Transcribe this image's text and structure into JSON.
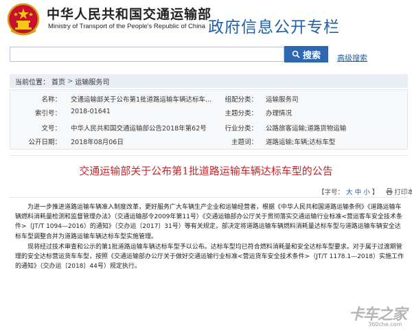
{
  "header": {
    "ministry_cn": "中华人民共和国交通运输部",
    "ministry_en": "Ministry of Transport of the People's Republic of China",
    "column_title": "政府信息公开专栏"
  },
  "search": {
    "placeholder": "",
    "button_label": "搜索",
    "advanced_label": "高级搜索"
  },
  "breadcrumb": {
    "prefix": "当前位置：",
    "home": "首页",
    "sep": ">",
    "current": "运输服务司"
  },
  "info": {
    "name_label": "名称：",
    "name_value": "交通运输部关于公布第1批道路运输车辆达标车...",
    "index_label": "索引号：",
    "index_value": "2018-01641",
    "docno_label": "文号：",
    "docno_value": "中华人民共和国交通运输部公告2018年第62号",
    "date_label": "公开日期：",
    "date_value": "2018年08月06日",
    "org_label": "组配分类：",
    "org_value": "运输服务司",
    "topic_label": "主题分类：",
    "topic_value": "办理情况",
    "industry_label": "行业分类：",
    "industry_value": "公路旅客运输;道路货物运输",
    "keyword_label": "主题词：",
    "keyword_value": "道路运输;车辆;达标车型"
  },
  "article": {
    "title": "交通运输部关于公布第1批道路运输车辆达标车型的公告",
    "font_label": "【字号：",
    "font_large": "大",
    "font_medium": "中",
    "font_small": "小",
    "font_close": "】",
    "print_label": "打印本页",
    "paragraph_1": "为进一步推进道路运输车辆准入制度改革，更好服务广大车辆生产企业和运输经营者，根据《中华人民共和国道路运输条例》《道路运输车辆燃料消耗量检测和监督管理办法》（交通运输部令2009年第11号）《交通运输部办公厅关于贯彻落实交通运输行业标准<营运客车安全技术条件>（JT/T 1094—2016）的通知》（交办运〔2017〕31号）等有关规定，部决定将道路运输车辆燃料消耗量达标车型与道路运输车辆安全达标车型调整合并为道路运输车辆达标车型实施管理。",
    "paragraph_2": "现将经过技术审查和公示的第1批道路运输车辆达标车型予以公布。达标车型均已符合燃料消耗量和安全达标车型要求。对于属于过渡期管理的安全达标营运货车车型，按照《交通运输部办公厅关于做好交通运输行业标准<营运货车安全技术条件>（JT/T 1178.1—2018）实施工作的通知》（交办运〔2018〕44号）规定执行。"
  },
  "watermark": {
    "main": "卡车之家",
    "sub": "360che.com"
  },
  "colors": {
    "accent": "#2d67b0",
    "title_red": "#c0282d",
    "column_blue": "#1f5fa8"
  }
}
